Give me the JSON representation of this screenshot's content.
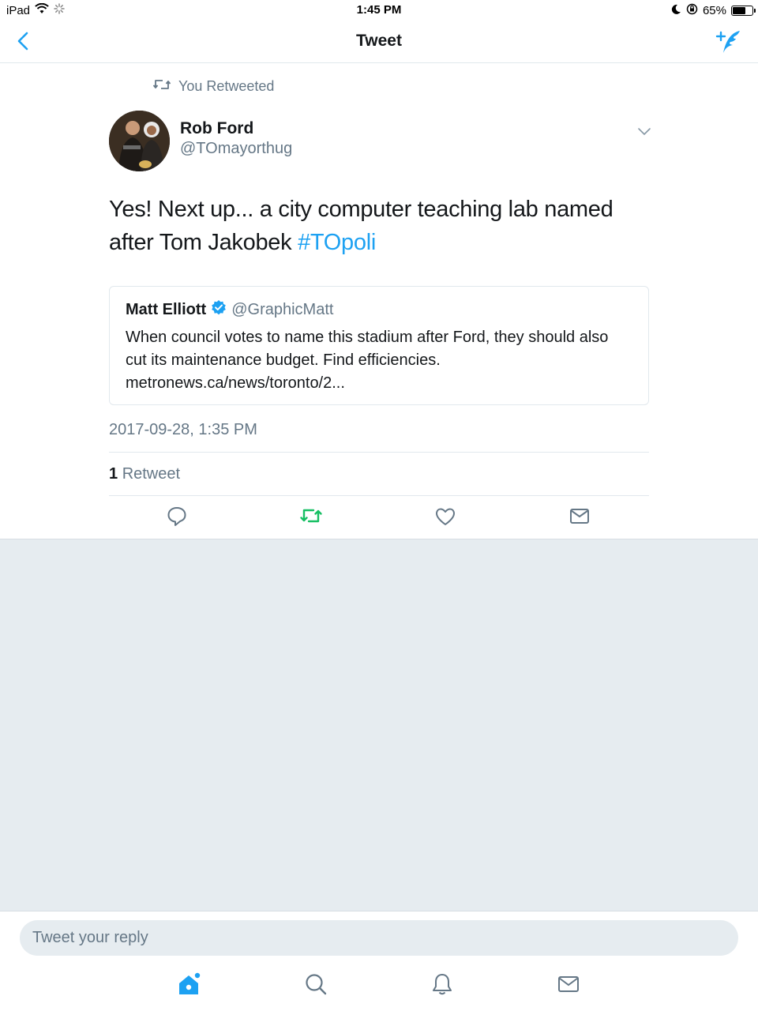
{
  "status_bar": {
    "device": "iPad",
    "time": "1:45 PM",
    "battery_percent": "65%",
    "battery_level": 0.65
  },
  "nav": {
    "title": "Tweet",
    "back_icon": "chevron-left-icon",
    "compose_icon": "compose-tweet-icon"
  },
  "tweet": {
    "retweet_label": "You Retweeted",
    "author_name": "Rob Ford",
    "author_handle": "@TOmayorthug",
    "text": "Yes! Next up... a city computer teaching lab named after Tom Jakobek ",
    "hashtag": "#TOpoli",
    "timestamp": "2017-09-28, 1:35 PM",
    "retweet_count": "1",
    "retweet_word": "Retweet"
  },
  "quote": {
    "author_name": "Matt Elliott",
    "author_handle": "@GraphicMatt",
    "verified": true,
    "text": "When council votes to name this stadium after Ford, they should also cut its maintenance budget. Find efficiencies. metronews.ca/news/toronto/2..."
  },
  "actions": {
    "reply_icon": "reply-icon",
    "retweet_icon": "retweet-icon",
    "like_icon": "heart-icon",
    "dm_icon": "mail-icon",
    "retweet_active_color": "#17bf63"
  },
  "reply": {
    "placeholder": "Tweet your reply"
  },
  "tabs": [
    "home-icon",
    "search-icon",
    "notifications-icon",
    "messages-icon"
  ],
  "colors": {
    "accent": "#1da1f2",
    "secondary_text": "#657786",
    "background_gray": "#e6ecf0"
  }
}
